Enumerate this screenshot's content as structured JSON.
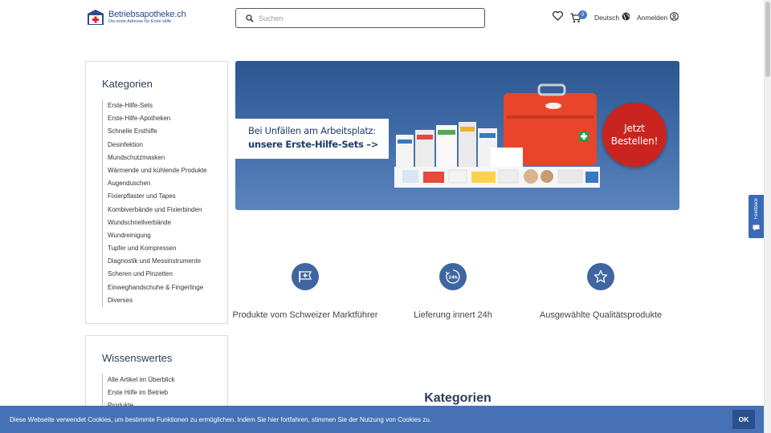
{
  "header": {
    "logo_name": "Betriebsapotheke.ch",
    "logo_tagline": "Die erste Adresse für Erste Hilfe",
    "search_placeholder": "Suchen",
    "cart_count": "0",
    "language_label": "Deutsch",
    "login_label": "Anmelden"
  },
  "sidebar": {
    "categories_title": "Kategorien",
    "categories": [
      "Erste-Hilfe-Sets",
      "Erste-Hilfe-Apotheken",
      "Schnelle Ersthilfe",
      "Desinfektion",
      "Mundschutzmasken",
      "Wärmende und kühlende Produkte",
      "Augenduschen",
      "Fixierpflaster und Tapes",
      "Kombiverbände und Fixierbinden",
      "Wundschnellverbände",
      "Wundreinigung",
      "Tupfer und Kompressen",
      "Diagnostik und Messinstrumente",
      "Scheren und Pinzetten",
      "Einweghandschuhe & Fingerlinge",
      "Diverses"
    ],
    "knowledge_title": "Wissenswertes",
    "knowledge": [
      "Alle Artikel im Überblick",
      "Erste Hilfe im Betrieb",
      "Produkte"
    ]
  },
  "hero": {
    "line1": "Bei Unfällen am Arbeitsplatz:",
    "line2": "unsere Erste-Hilfe-Sets –>",
    "cta_line1": "Jetzt",
    "cta_line2": "Bestellen!"
  },
  "features": [
    {
      "icon": "swiss-flag-icon",
      "text": "Produkte vom Schweizer Marktführer"
    },
    {
      "icon": "24h-clock-icon",
      "text": "Lieferung innert 24h"
    },
    {
      "icon": "star-icon",
      "text": "Ausgewählte Qualitätsprodukte"
    }
  ],
  "section_title": "Kategorien",
  "feedback_label": "Feedback",
  "cookie": {
    "text": "Diese Webseite verwendet Cookies, um bestimmte Funktionen zu ermöglichen. Indem Sie hier fortfahren, stimmen Sie der Nutzung von Cookies zu.",
    "ok_label": "OK"
  },
  "colors": {
    "brand_blue": "#3f66a0",
    "cookie_bar": "#4672b5",
    "cta_red": "#c9241f"
  }
}
